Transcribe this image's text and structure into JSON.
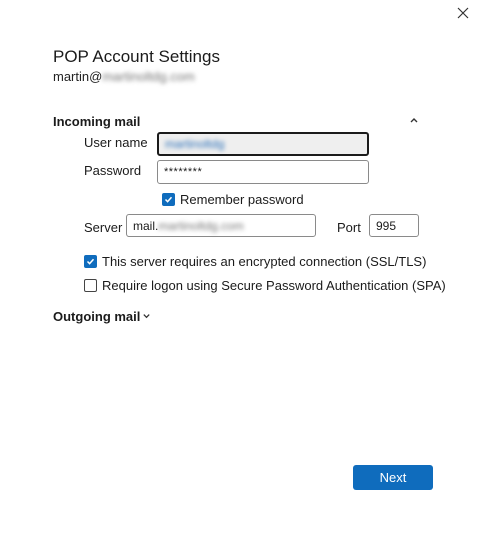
{
  "dialog": {
    "title": "POP Account Settings",
    "account_prefix": "martin@",
    "account_domain_blurred": "martinoltdg.com",
    "close_icon": "close-icon"
  },
  "incoming": {
    "heading": "Incoming mail",
    "collapse_icon": "chevron-up-icon",
    "username_label": "User name",
    "username_value_blurred": "martinoltdg",
    "password_label": "Password",
    "password_value": "********",
    "remember_label": "Remember password",
    "remember_checked": true,
    "server_label": "Server",
    "server_prefix": "mail.",
    "server_domain_blurred": "martinoltdg.com",
    "port_label": "Port",
    "port_value": "995",
    "ssl_label": "This server requires an encrypted connection (SSL/TLS)",
    "ssl_checked": true,
    "spa_label": "Require logon using Secure Password Authentication (SPA)",
    "spa_checked": false
  },
  "outgoing": {
    "heading": "Outgoing mail",
    "expand_icon": "chevron-down-icon"
  },
  "actions": {
    "next_label": "Next"
  },
  "colors": {
    "accent": "#0f6cbd"
  }
}
